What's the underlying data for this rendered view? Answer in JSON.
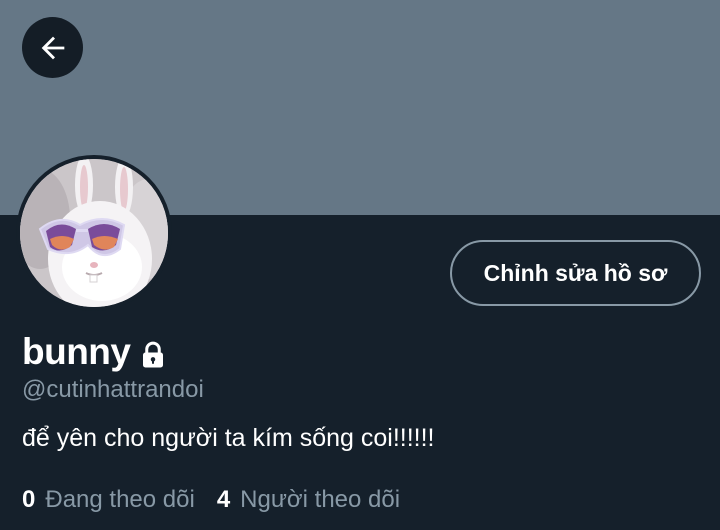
{
  "profile": {
    "display_name": "bunny",
    "handle": "@cutinhattrandoi",
    "bio": "để yên cho người ta kím sống coi!!!!!!",
    "edit_button_label": "Chỉnh sửa hồ sơ",
    "locked": true
  },
  "stats": {
    "following_count": "0",
    "following_label": "Đang theo dõi",
    "followers_count": "4",
    "followers_label": "Người theo dõi"
  },
  "icons": {
    "back": "arrow-left-icon",
    "lock": "lock-icon"
  },
  "colors": {
    "background": "#15202b",
    "banner": "#657786",
    "secondary_text": "#8899a6",
    "primary_text": "#ffffff"
  }
}
